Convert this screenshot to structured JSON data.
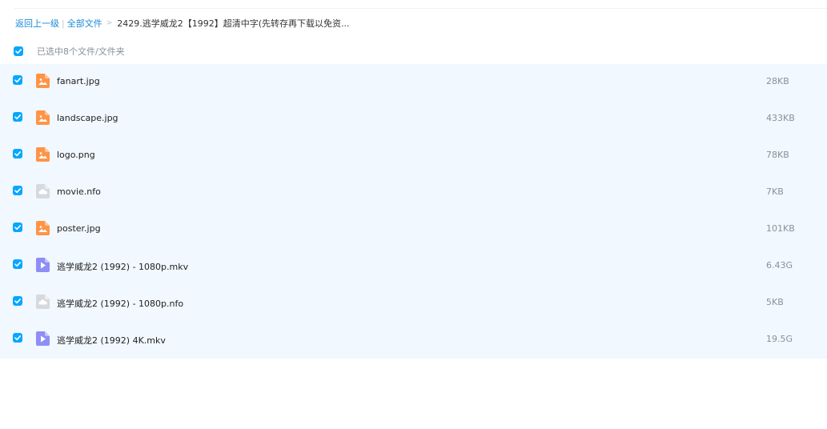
{
  "breadcrumb": {
    "back_label": "返回上一级",
    "separator": "|",
    "all_files_label": "全部文件",
    "arrow": ">",
    "current_folder": "2429.逃学威龙2【1992】超清中字(先转存再下载以免资..."
  },
  "selection": {
    "summary": "已选中8个文件/文件夹",
    "all_checked": true
  },
  "colors": {
    "accent": "#06a7ff",
    "link": "#1a8ad8",
    "row_background": "#f1f8ff",
    "image_icon": "#ff9447",
    "video_icon": "#8f8df6",
    "nfo_icon": "#d6d9de"
  },
  "files": [
    {
      "name": "fanart.jpg",
      "size": "28KB",
      "icon": "image-file-icon",
      "checked": true
    },
    {
      "name": "landscape.jpg",
      "size": "433KB",
      "icon": "image-file-icon",
      "checked": true
    },
    {
      "name": "logo.png",
      "size": "78KB",
      "icon": "image-file-icon",
      "checked": true
    },
    {
      "name": "movie.nfo",
      "size": "7KB",
      "icon": "unknown-file-icon",
      "checked": true
    },
    {
      "name": "poster.jpg",
      "size": "101KB",
      "icon": "image-file-icon",
      "checked": true
    },
    {
      "name": "逃学威龙2 (1992) - 1080p.mkv",
      "size": "6.43G",
      "icon": "video-file-icon",
      "checked": true
    },
    {
      "name": "逃学威龙2 (1992) - 1080p.nfo",
      "size": "5KB",
      "icon": "unknown-file-icon",
      "checked": true
    },
    {
      "name": "逃学威龙2 (1992) 4K.mkv",
      "size": "19.5G",
      "icon": "video-file-icon",
      "checked": true
    }
  ]
}
